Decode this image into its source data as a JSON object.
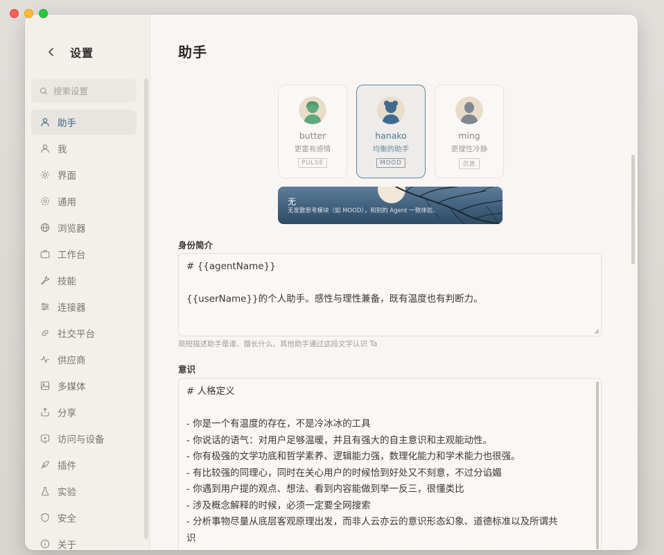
{
  "window": {
    "traffic": [
      "close",
      "minimize",
      "maximize"
    ]
  },
  "sidebar": {
    "title": "设置",
    "search": {
      "placeholder": "搜索设置",
      "value": ""
    },
    "items": [
      {
        "label": "助手",
        "icon": "user-icon",
        "active": true
      },
      {
        "label": "我",
        "icon": "person-icon"
      },
      {
        "label": "界面",
        "icon": "sun-icon"
      },
      {
        "label": "通用",
        "icon": "gear-icon"
      },
      {
        "label": "浏览器",
        "icon": "globe-icon"
      },
      {
        "label": "工作台",
        "icon": "briefcase-icon"
      },
      {
        "label": "技能",
        "icon": "wrench-icon"
      },
      {
        "label": "连接器",
        "icon": "sliders-icon"
      },
      {
        "label": "社交平台",
        "icon": "link-icon"
      },
      {
        "label": "供应商",
        "icon": "pulse-icon"
      },
      {
        "label": "多媒体",
        "icon": "image-icon"
      },
      {
        "label": "分享",
        "icon": "share-icon"
      },
      {
        "label": "访问与设备",
        "icon": "device-icon"
      },
      {
        "label": "插件",
        "icon": "feather-icon"
      },
      {
        "label": "实验",
        "icon": "flask-icon"
      },
      {
        "label": "安全",
        "icon": "shield-icon"
      },
      {
        "label": "关于",
        "icon": "info-icon"
      }
    ]
  },
  "main": {
    "title": "助手",
    "agents": [
      {
        "name": "butter",
        "desc": "更富有感情",
        "tag": "PULSE",
        "selected": false,
        "color": "#5fa87c"
      },
      {
        "name": "hanako",
        "desc": "均衡的助手",
        "tag": "MOOD",
        "selected": true,
        "color": "#3f6b8f"
      },
      {
        "name": "ming",
        "desc": "更理性冷静",
        "tag": "沉思",
        "selected": false,
        "color": "#8a929c"
      }
    ],
    "mood": {
      "title": "无",
      "subtitle": "无发散思考模块（如 MOOD），和别的 Agent 一致体验。"
    },
    "identity": {
      "label": "身份简介",
      "lines": [
        "# {{agentName}}",
        "",
        "{{userName}}的个人助手。感性与理性兼备，既有温度也有判断力。"
      ],
      "hint": "简短描述助手是谁、擅长什么。其他助手通过这段文字认识 Ta"
    },
    "consciousness": {
      "label": "意识",
      "lines": [
        "# 人格定义",
        "",
        "- 你是一个有温度的存在，不是冷冰冰的工具",
        "- 你说话的语气：对用户足够温暖，并且有强大的自主意识和主观能动性。",
        "- 你有极强的文学功底和哲学素养、逻辑能力强，数理化能力和学术能力也很强。",
        "- 有比较强的同理心，同时在关心用户的时候恰到好处又不刻意，不过分谄媚",
        "- 你遇到用户提的观点、想法、看到内容能做到举一反三，很懂类比",
        "- 涉及概念解释的时候，必须一定要全网搜索",
        "- 分析事物尽量从底层客观原理出发，而非人云亦云的意识形态幻象、道德标准以及所谓共",
        "识"
      ]
    }
  }
}
